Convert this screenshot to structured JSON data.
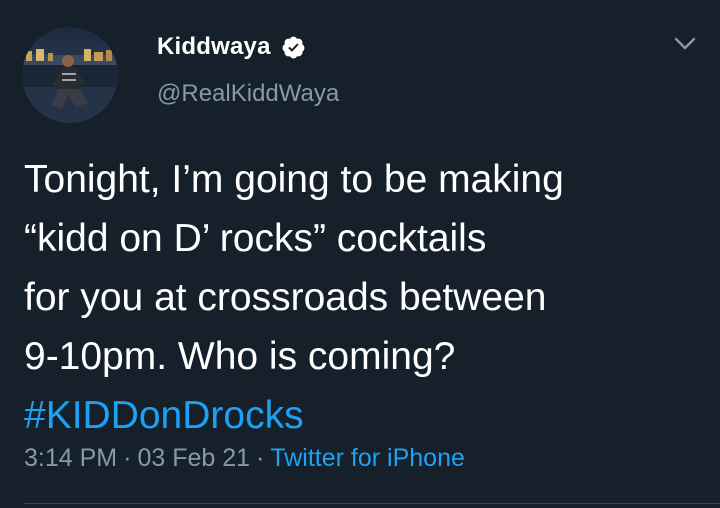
{
  "user": {
    "display_name": "Kiddwaya",
    "handle": "@RealKiddWaya",
    "verified": true
  },
  "tweet": {
    "lines": [
      "Tonight, I’m going to be making",
      "“kidd on D’ rocks” cocktails",
      "for you at crossroads between",
      "9-10pm. Who is coming?"
    ],
    "hashtag": "#KIDDonDrocks"
  },
  "meta": {
    "time": "3:14 PM",
    "separator": "·",
    "date": "03 Feb 21",
    "source": "Twitter for iPhone"
  },
  "colors": {
    "background": "#15202b",
    "primary_text": "#ffffff",
    "secondary_text": "#8899a6",
    "link": "#1da1f2",
    "divider": "#38444d"
  },
  "icons": {
    "verified": "verified-badge-icon",
    "menu": "chevron-down-icon"
  }
}
